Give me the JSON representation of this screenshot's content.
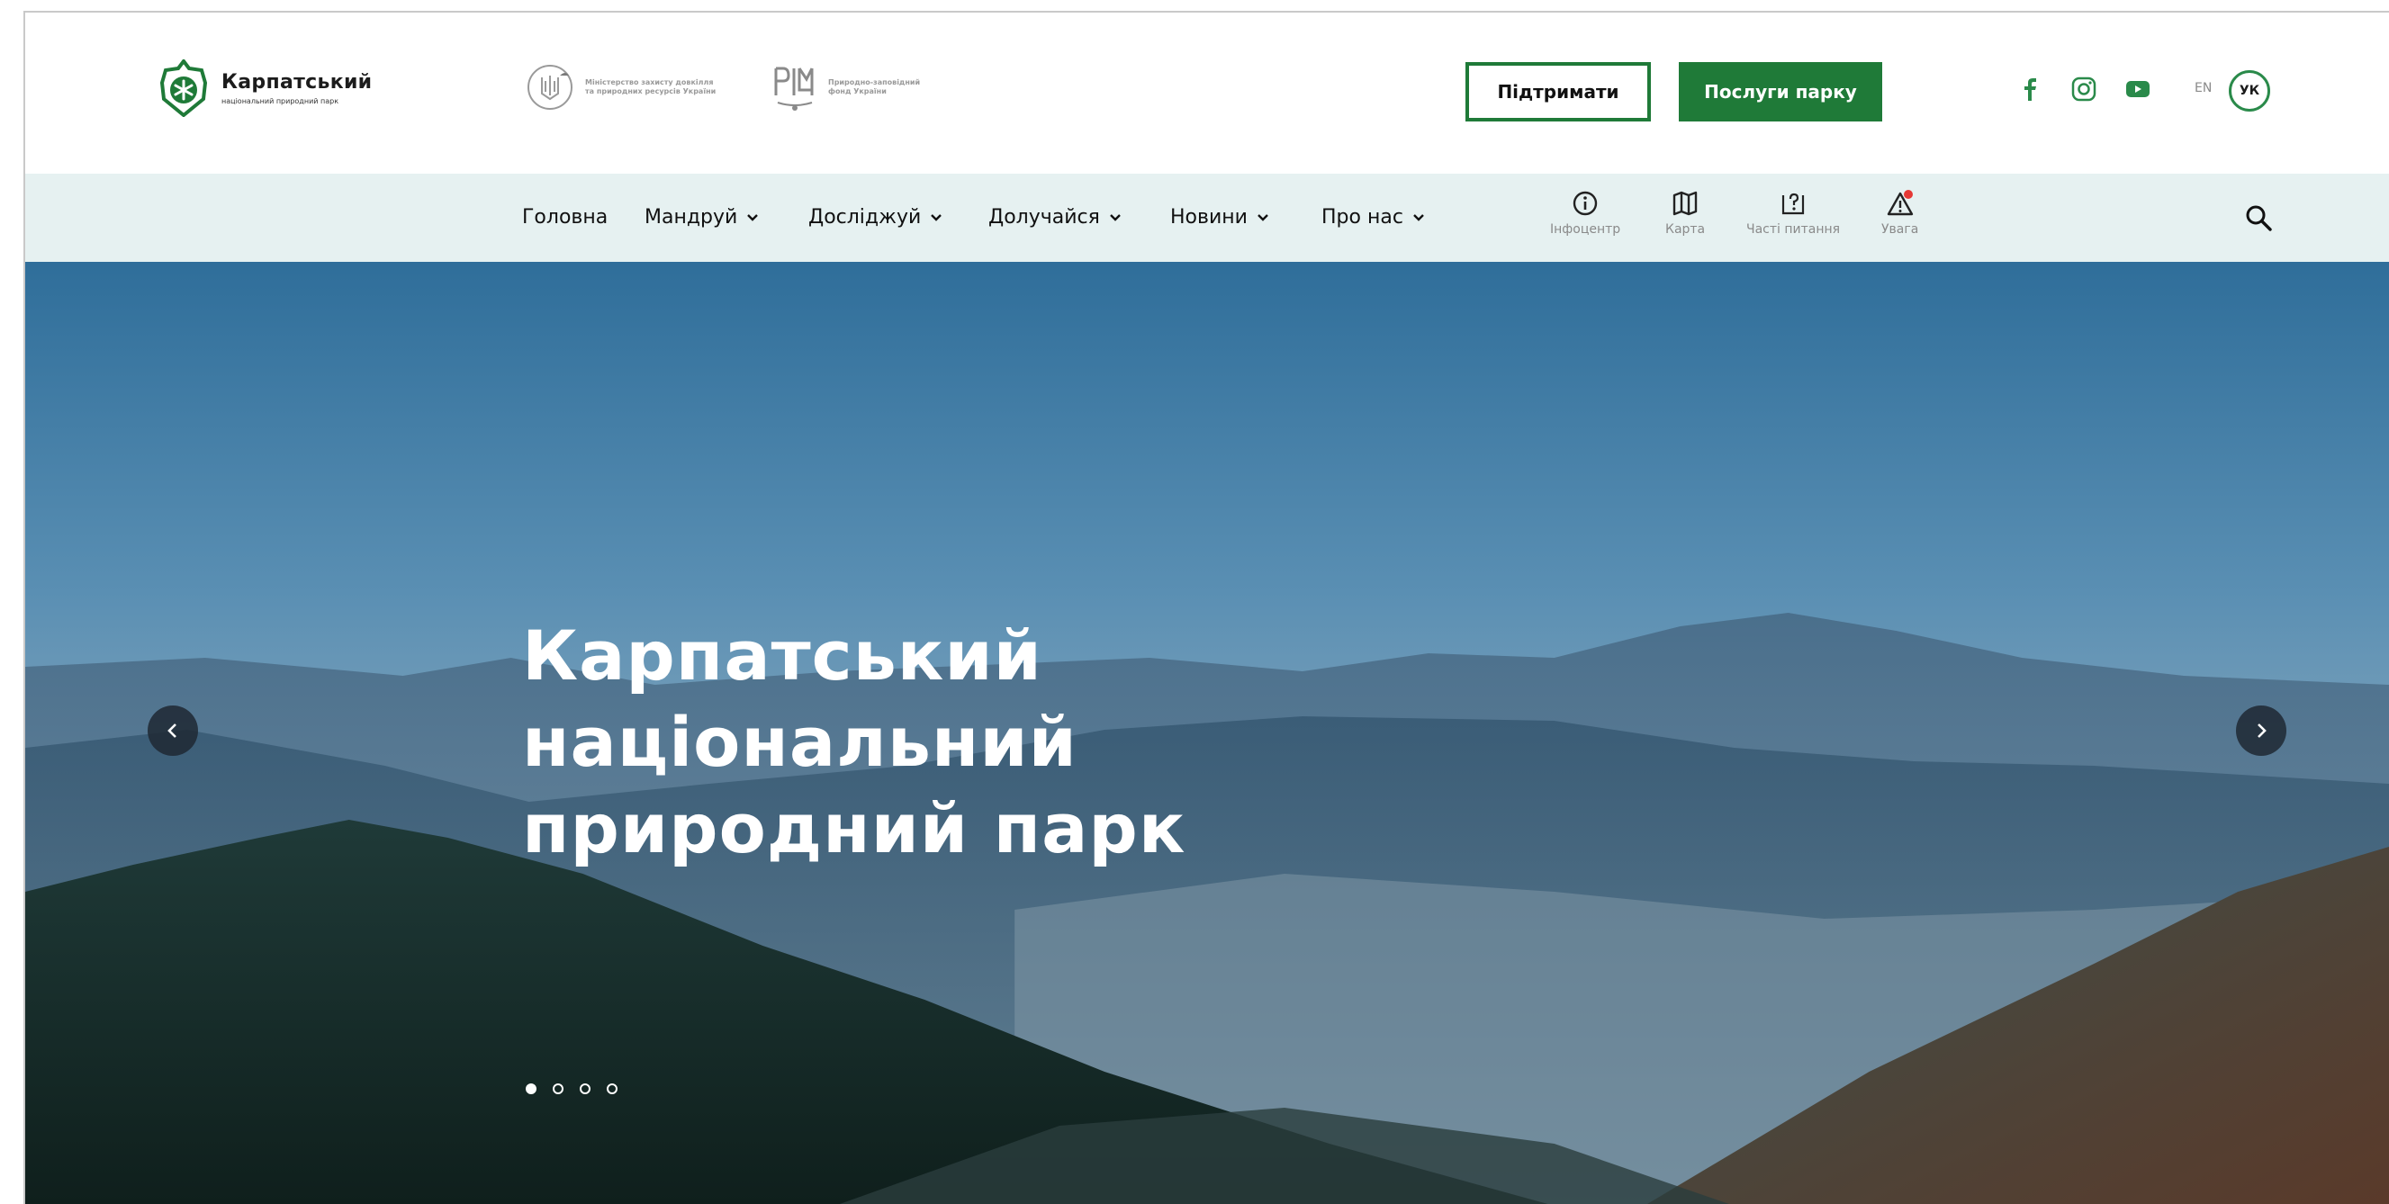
{
  "header": {
    "logo": {
      "title": "Карпатський",
      "subtitle": "національний природний парк"
    },
    "partners": [
      {
        "text": "Міністерство захисту довкілля та природних ресурсів України"
      },
      {
        "text": "Природно-заповідний фонд України"
      }
    ],
    "support_button": "Підтримати",
    "services_button": "Послуги парку",
    "social": [
      "facebook-icon",
      "instagram-icon",
      "youtube-icon"
    ],
    "lang_en": "EN",
    "lang_uk": "УК"
  },
  "nav": {
    "items": [
      "Головна",
      "Мандруй",
      "Досліджуй",
      "Долучайся",
      "Новини",
      "Про нас"
    ],
    "tools": [
      "Інфоцентр",
      "Карта",
      "Часті питання",
      "Увага"
    ]
  },
  "hero": {
    "title": "Карпатський\nнаціональний\nприродний парк",
    "slides": 4,
    "active_slide": 1
  },
  "colors": {
    "brand_green": "#1f7a38",
    "nav_bg": "#e6f1f1",
    "alert_red": "#e53935"
  }
}
